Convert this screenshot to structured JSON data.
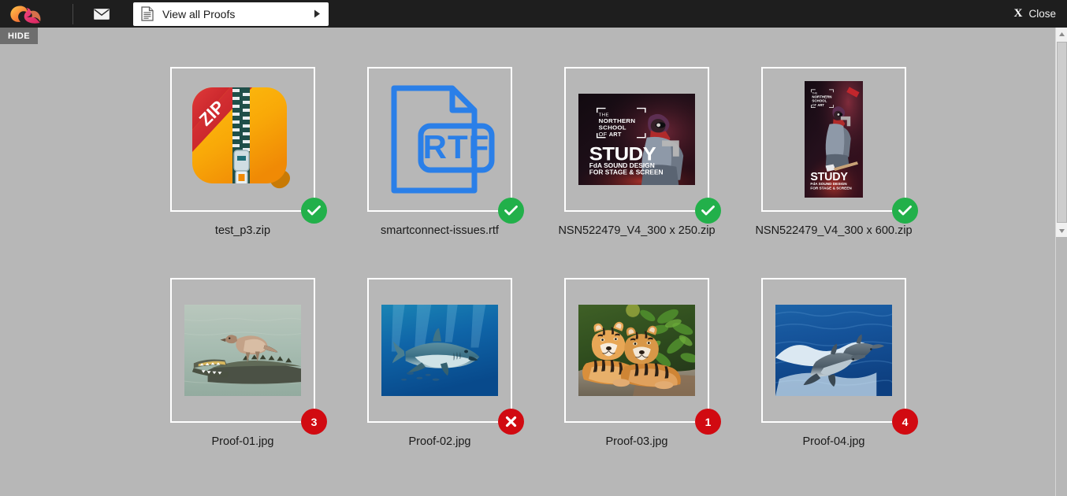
{
  "topbar": {
    "logo_icon": "cloud-swirl-logo",
    "mail_icon": "envelope-icon",
    "proofs_button": {
      "icon": "document-list-icon",
      "label": "View all Proofs",
      "caret_icon": "caret-right-icon"
    },
    "close": {
      "x_label": "X",
      "label": "Close",
      "icon": "close-icon"
    }
  },
  "hide_tab": {
    "label": "HIDE"
  },
  "colors": {
    "topbar_bg": "#1e1e1e",
    "content_bg": "#b7b7b7",
    "card_border": "#ffffff",
    "approved_badge": "#22b04a",
    "rejected_badge": "#d10a11",
    "comment_badge": "#d10a11",
    "hide_tab_bg": "#6e6e6e",
    "rtf_blue": "#2a7fe8",
    "zip_orange": "#f7a70c",
    "zip_red": "#cc1f26"
  },
  "scrollbar": {
    "up_arrow_icon": "scroll-up-arrow-icon",
    "down_arrow_icon": "scroll-down-arrow-icon",
    "thumb_name": "scrollbar-thumb"
  },
  "files": [
    {
      "name": "test_p3.zip",
      "thumb_type": "zip-icon",
      "thumb_alt": "ZIP archive file icon, orange rounded square with red ZIP ribbon and zipper",
      "badge": {
        "kind": "approved",
        "icon": "check-icon",
        "text": ""
      }
    },
    {
      "name": "smartconnect-issues.rtf",
      "thumb_type": "rtf-icon",
      "thumb_alt": "RTF document file icon, blue outlined page with RTF label",
      "badge": {
        "kind": "approved",
        "icon": "check-icon",
        "text": ""
      }
    },
    {
      "name": "NSN522479_V4_300 x 250.zip",
      "thumb_type": "banner-300x250",
      "thumb_alt": "Dark banner advert: The Northern School of Art - STUDY FdA Sound Design for Stage & Screen",
      "banner_text": {
        "brand_line1": "THE",
        "brand_line2": "NORTHERN",
        "brand_line3": "SCHOOL",
        "brand_line4": "OF ART",
        "headline": "STUDY",
        "sub1": "FdA SOUND DESIGN",
        "sub2": "FOR STAGE & SCREEN"
      },
      "badge": {
        "kind": "approved",
        "icon": "check-icon",
        "text": ""
      }
    },
    {
      "name": "NSN522479_V4_300 x 600.zip",
      "thumb_type": "banner-300x600",
      "thumb_alt": "Tall dark banner advert: The Northern School of Art - STUDY FdA Sound Design for Stage & Screen",
      "banner_text": {
        "brand_line1": "THE",
        "brand_line2": "NORTHERN",
        "brand_line3": "SCHOOL",
        "brand_line4": "OF ART",
        "headline": "STUDY",
        "sub1": "FdA SOUND DESIGN",
        "sub2": "FOR STAGE & SCREEN"
      },
      "badge": {
        "kind": "approved",
        "icon": "check-icon",
        "text": ""
      }
    },
    {
      "name": "Proof-01.jpg",
      "thumb_type": "photo-crocodile",
      "thumb_alt": "Photograph of a crocodile in water with a bird standing on its back",
      "badge": {
        "kind": "comments",
        "icon": "comment-count-badge",
        "text": "3"
      }
    },
    {
      "name": "Proof-02.jpg",
      "thumb_type": "photo-shark",
      "thumb_alt": "Photograph of a shark swimming underwater in blue sea",
      "badge": {
        "kind": "rejected",
        "icon": "cross-icon",
        "text": ""
      }
    },
    {
      "name": "Proof-03.jpg",
      "thumb_type": "photo-tigers",
      "thumb_alt": "Photograph of two tigers resting on a rock among green foliage",
      "badge": {
        "kind": "comments",
        "icon": "comment-count-badge",
        "text": "1"
      }
    },
    {
      "name": "Proof-04.jpg",
      "thumb_type": "photo-dolphins",
      "thumb_alt": "Photograph of two dolphins leaping out of blue ocean water",
      "badge": {
        "kind": "comments",
        "icon": "comment-count-badge",
        "text": "4"
      }
    }
  ]
}
